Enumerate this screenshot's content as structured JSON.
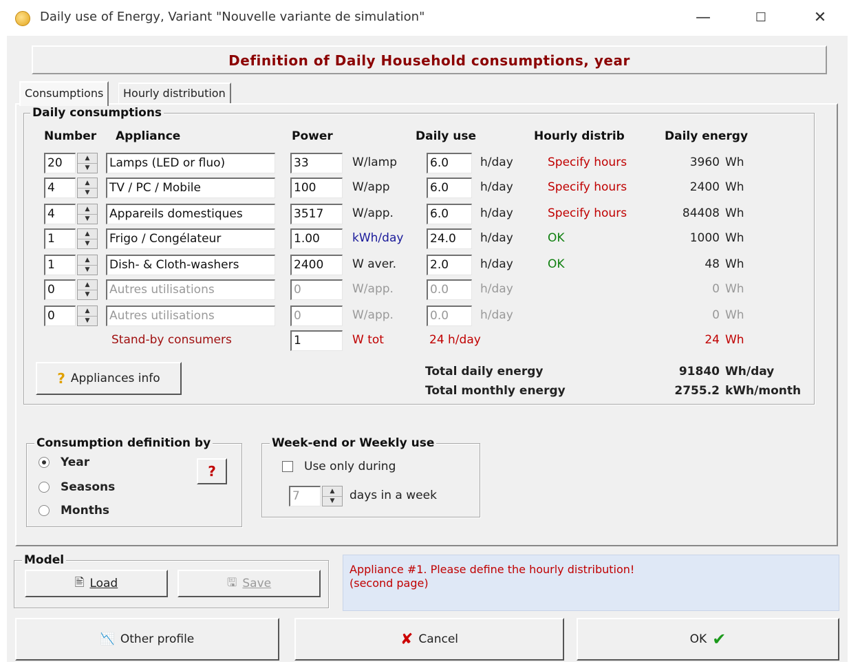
{
  "window": {
    "title": "Daily use of Energy, Variant \"Nouvelle variante de simulation\"",
    "minimize": "—",
    "maximize": "☐",
    "close": "✕"
  },
  "header": {
    "title": "Definition of Daily Household consumptions, year"
  },
  "tabs": [
    {
      "label": "Consumptions"
    },
    {
      "label": "Hourly distribution"
    }
  ],
  "daily": {
    "caption": "Daily consumptions",
    "columns": {
      "number": "Number",
      "appliance": "Appliance",
      "power": "Power",
      "daily_use": "Daily use",
      "hourly_distrib": "Hourly distrib",
      "daily_energy": "Daily energy"
    },
    "rows": [
      {
        "number": "20",
        "appliance": "Lamps (LED or fluo)",
        "power": "33",
        "power_unit": "W/lamp",
        "use": "6.0",
        "use_unit": "h/day",
        "distrib": "Specify hours",
        "energy": "3960",
        "energy_unit": "Wh"
      },
      {
        "number": "4",
        "appliance": "TV / PC / Mobile",
        "power": "100",
        "power_unit": "W/app",
        "use": "6.0",
        "use_unit": "h/day",
        "distrib": "Specify hours",
        "energy": "2400",
        "energy_unit": "Wh"
      },
      {
        "number": "4",
        "appliance": "Appareils domestiques",
        "power": "3517",
        "power_unit": "W/app.",
        "use": "6.0",
        "use_unit": "h/day",
        "distrib": "Specify hours",
        "energy": "84408",
        "energy_unit": "Wh"
      },
      {
        "number": "1",
        "appliance": "Frigo / Congélateur",
        "power": "1.00",
        "power_unit": "kWh/day",
        "use": "24.0",
        "use_unit": "h/day",
        "distrib": "OK",
        "energy": "1000",
        "energy_unit": "Wh"
      },
      {
        "number": "1",
        "appliance": "Dish- & Cloth-washers",
        "power": "2400",
        "power_unit": "W aver.",
        "use": "2.0",
        "use_unit": "h/day",
        "distrib": "OK",
        "energy": "48",
        "energy_unit": "Wh"
      },
      {
        "number": "0",
        "appliance": "Autres utilisations",
        "power": "0",
        "power_unit": "W/app.",
        "use": "0.0",
        "use_unit": "h/day",
        "distrib": "",
        "energy": "0",
        "energy_unit": "Wh"
      },
      {
        "number": "0",
        "appliance": "Autres utilisations",
        "power": "0",
        "power_unit": "W/app.",
        "use": "0.0",
        "use_unit": "h/day",
        "distrib": "",
        "energy": "0",
        "energy_unit": "Wh"
      }
    ],
    "standby": {
      "label": "Stand-by consumers",
      "power": "1",
      "power_unit": "W tot",
      "use": "24 h/day",
      "energy": "24",
      "energy_unit": "Wh"
    },
    "appliances_info": "Appliances info",
    "totals": {
      "daily_label": "Total daily energy",
      "daily_value": "91840",
      "daily_unit": "Wh/day",
      "monthly_label": "Total monthly energy",
      "monthly_value": "2755.2",
      "monthly_unit": "kWh/month"
    }
  },
  "definition_by": {
    "caption": "Consumption definition by",
    "options": [
      "Year",
      "Seasons",
      "Months"
    ],
    "selected": "Year",
    "help": "?"
  },
  "weekend": {
    "caption": "Week-end or Weekly use",
    "checkbox_label": "Use only during",
    "days": "7",
    "days_label": "days in a week"
  },
  "model": {
    "caption": "Model",
    "load": "Load",
    "save": "Save"
  },
  "message": {
    "line1": "Appliance #1. Please define the hourly distribution!",
    "line2": "(second page)"
  },
  "footer": {
    "other_profile": "Other profile",
    "cancel": "Cancel",
    "ok": "OK"
  }
}
